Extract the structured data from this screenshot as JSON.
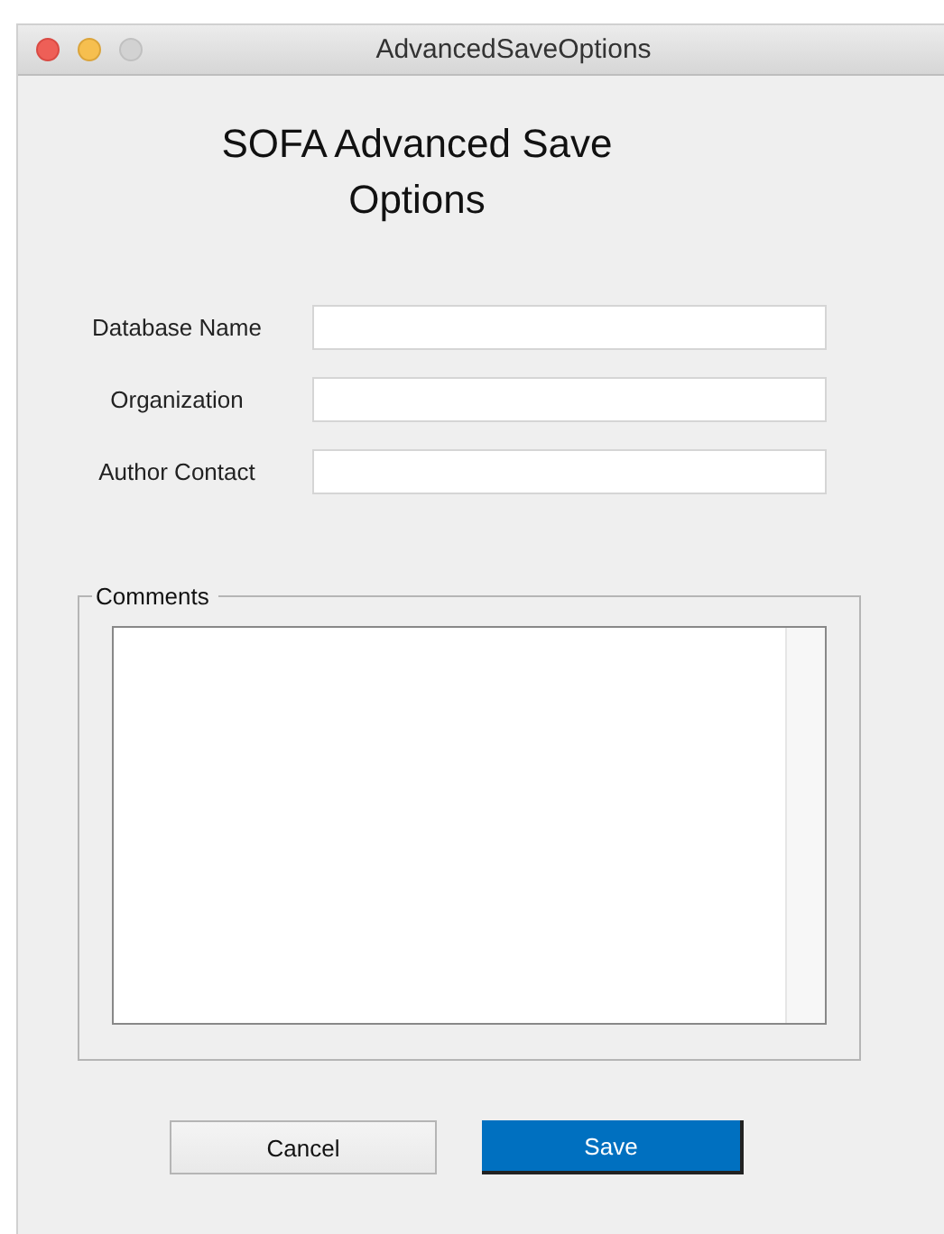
{
  "window": {
    "title": "AdvancedSaveOptions"
  },
  "heading": "SOFA Advanced Save Options",
  "fields": [
    {
      "label": "Database Name"
    },
    {
      "label": "Organization"
    },
    {
      "label": "Author Contact"
    }
  ],
  "comments": {
    "label": "Comments"
  },
  "buttons": [
    {
      "label": "Cancel",
      "default": false
    },
    {
      "label": "Save",
      "default": true
    }
  ]
}
